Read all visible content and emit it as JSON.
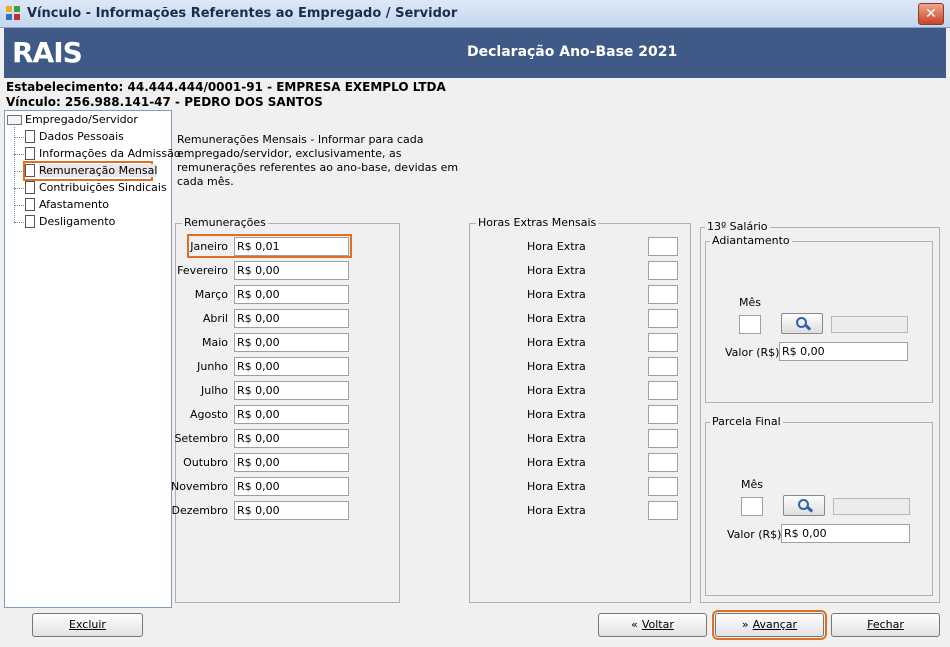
{
  "window": {
    "title": "Vínculo - Informações Referentes ao Empregado / Servidor",
    "close": "✕"
  },
  "banner": {
    "logo": "RAIS",
    "title": "Declaração Ano-Base 2021"
  },
  "header": {
    "estabelecimento": "Estabelecimento: 44.444.444/0001-91 - EMPRESA EXEMPLO LTDA",
    "vinculo": "Vínculo: 256.988.141-47 - PEDRO DOS SANTOS"
  },
  "tree": {
    "root": "Empregado/Servidor",
    "items": [
      {
        "label": "Dados Pessoais"
      },
      {
        "label": "Informações da Admissão"
      },
      {
        "label": "Remuneração Mensal"
      },
      {
        "label": "Contribuições Sindicais"
      },
      {
        "label": "Afastamento"
      },
      {
        "label": "Desligamento"
      }
    ]
  },
  "description": "Remunerações Mensais - Informar para cada empregado/servidor, exclusivamente, as remunerações referentes ao ano-base, devidas em cada mês.",
  "remuneracoes": {
    "legend": "Remunerações",
    "months": [
      {
        "label": "Janeiro",
        "value": "R$ 0,01"
      },
      {
        "label": "Fevereiro",
        "value": "R$ 0,00"
      },
      {
        "label": "Março",
        "value": "R$ 0,00"
      },
      {
        "label": "Abril",
        "value": "R$ 0,00"
      },
      {
        "label": "Maio",
        "value": "R$ 0,00"
      },
      {
        "label": "Junho",
        "value": "R$ 0,00"
      },
      {
        "label": "Julho",
        "value": "R$ 0,00"
      },
      {
        "label": "Agosto",
        "value": "R$ 0,00"
      },
      {
        "label": "Setembro",
        "value": "R$ 0,00"
      },
      {
        "label": "Outubro",
        "value": "R$ 0,00"
      },
      {
        "label": "Novembro",
        "value": "R$ 0,00"
      },
      {
        "label": "Dezembro",
        "value": "R$ 0,00"
      }
    ]
  },
  "horas_extras": {
    "legend": "Horas Extras Mensais",
    "row_label": "Hora Extra"
  },
  "decimo_terceiro": {
    "legend": "13º Salário",
    "adiantamento": {
      "legend": "Adiantamento",
      "mes_label": "Mês",
      "valor_label": "Valor (R$)",
      "valor": "R$ 0,00"
    },
    "parcela_final": {
      "legend": "Parcela Final",
      "mes_label": "Mês",
      "valor_label": "Valor (R$)",
      "valor": "R$ 0,00"
    }
  },
  "buttons": {
    "excluir": "Excluir",
    "voltar": "Voltar",
    "avancar": "Avançar",
    "fechar": "Fechar"
  },
  "icons": {
    "search": "magnifier-icon",
    "back": "double-chevron-left-icon",
    "forward": "double-chevron-right-icon"
  },
  "colors": {
    "banner": "#3f5a87",
    "highlight": "#e07020"
  }
}
